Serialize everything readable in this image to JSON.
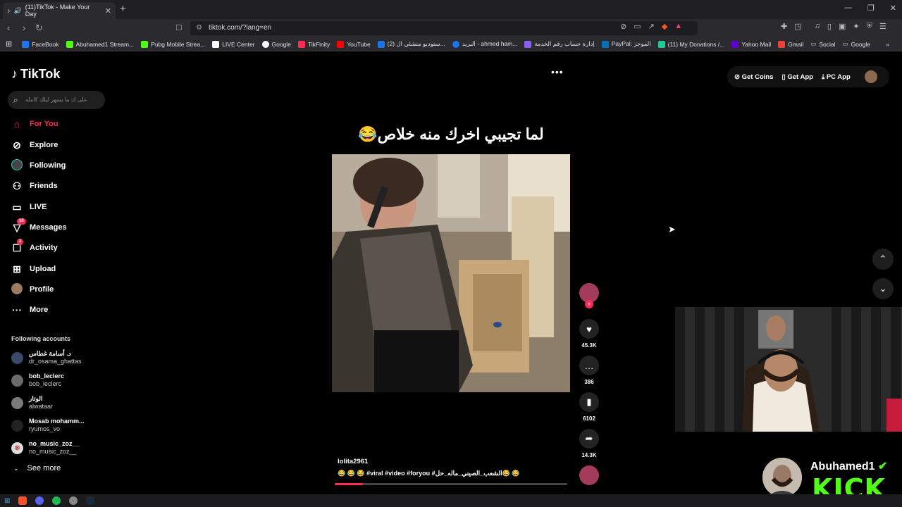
{
  "browser": {
    "tab_title": "(11)TikTok - Make Your Day",
    "url": "tiktok.com/?lang=en",
    "bookmarks": [
      {
        "label": "FaceBook",
        "color": "#1877f2"
      },
      {
        "label": "Abuhamed1 Stream...",
        "color": "#53fc18"
      },
      {
        "label": "Pubg Mobile Strea...",
        "color": "#53fc18"
      },
      {
        "label": "LIVE Center",
        "color": "#ffffff"
      },
      {
        "label": "Google",
        "color": "#ffffff"
      },
      {
        "label": "TikFinity",
        "color": "#fe2c55"
      },
      {
        "label": "YouTube",
        "color": "#ff0000"
      },
      {
        "label": "(2) ستوديو منشئي ال...",
        "color": "#1a73e8"
      },
      {
        "label": "البريد - ahmed ham...",
        "color": "#1a73e8"
      },
      {
        "label": "إدارة حساب رقم الخدمة",
        "color": "#8b5cf6"
      },
      {
        "label": "PayPal: الموجز",
        "color": "#0070ba"
      },
      {
        "label": "(11) My Donations /...",
        "color": "#20c997"
      },
      {
        "label": "Yahoo Mail",
        "color": "#6001d2"
      },
      {
        "label": "Gmail",
        "color": "#ea4335"
      },
      {
        "label": "Social",
        "color": "#888888"
      },
      {
        "label": "Google",
        "color": "#888888"
      }
    ]
  },
  "tiktok": {
    "logo": "TikTok",
    "search_placeholder": "على ك ما يسهر ليلك كامله",
    "nav": [
      {
        "label": "For You",
        "icon": "home-icon"
      },
      {
        "label": "Explore",
        "icon": "compass-icon"
      },
      {
        "label": "Following",
        "icon": "following-icon"
      },
      {
        "label": "Friends",
        "icon": "friends-icon"
      },
      {
        "label": "LIVE",
        "icon": "live-icon"
      },
      {
        "label": "Messages",
        "icon": "messages-icon",
        "badge": "10"
      },
      {
        "label": "Activity",
        "icon": "activity-icon",
        "badge": "1"
      },
      {
        "label": "Upload",
        "icon": "upload-icon"
      },
      {
        "label": "Profile",
        "icon": "profile-icon"
      },
      {
        "label": "More",
        "icon": "more-icon"
      }
    ],
    "following_title": "Following accounts",
    "accounts": [
      {
        "name": "د. أسامة غطاس",
        "user": "dr_osama_ghattas"
      },
      {
        "name": "bob_leclerc",
        "user": "bob_leclerc"
      },
      {
        "name": "الوتار",
        "user": "alwataar"
      },
      {
        "name": "Mosab mohamm...",
        "user": "ryumos_vo"
      },
      {
        "name": "no_music_zoz__",
        "user": "no_music_zoz__"
      }
    ],
    "see_more": "See more",
    "header": {
      "get_coins": "Get Coins",
      "get_app": "Get App",
      "pc_app": "PC App"
    },
    "video": {
      "caption_overlay": "لما تجيبي اخرك منه خلاص😂",
      "author": "lolita2961",
      "description": "😂 😂 😂 #viral #video #foryou #الشعب_الصيني_ماله_حل😂 😂",
      "progress": 0.12,
      "likes": "45.3K",
      "comments": "386",
      "saves": "6102",
      "shares": "14.3K"
    }
  },
  "overlay": {
    "streamer_name": "Abuhamed1",
    "platform": "KICK"
  }
}
